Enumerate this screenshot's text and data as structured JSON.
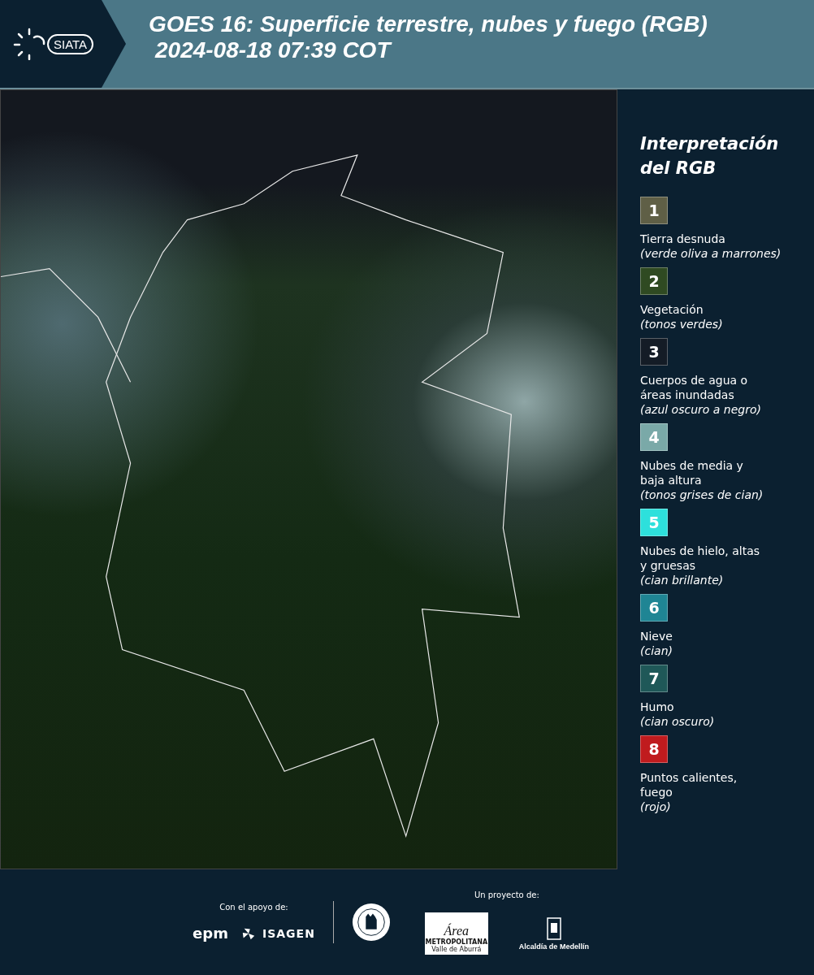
{
  "header": {
    "logo_text": "SIATA",
    "title": "GOES 16: Superficie terrestre, nubes y fuego (RGB)",
    "timestamp": "2024-08-18 07:39 COT"
  },
  "legend": {
    "title": "Interpretación del RGB",
    "items": [
      {
        "number": "1",
        "color": "#5f5f46",
        "label": "Tierra desnuda",
        "note": "(verde oliva a marrones)"
      },
      {
        "number": "2",
        "color": "#2f4a22",
        "label": "Vegetación",
        "note": "(tonos verdes)"
      },
      {
        "number": "3",
        "color": "#141c26",
        "label": "Cuerpos de agua o áreas inundadas",
        "note": "(azul oscuro a negro)"
      },
      {
        "number": "4",
        "color": "#7aa9a8",
        "label": "Nubes de media y baja altura",
        "note": "(tonos grises de cian)"
      },
      {
        "number": "5",
        "color": "#2de0dc",
        "label": "Nubes de hielo, altas y gruesas",
        "note": "(cian brillante)"
      },
      {
        "number": "6",
        "color": "#1f8594",
        "label": "Nieve",
        "note": "(cian)"
      },
      {
        "number": "7",
        "color": "#1f5858",
        "label": "Humo",
        "note": "(cian oscuro)"
      },
      {
        "number": "8",
        "color": "#c01b1e",
        "label": "Puntos calientes, fuego",
        "note": "(rojo)"
      }
    ]
  },
  "footer": {
    "support_label": "Con el apoyo de:",
    "project_label": "Un proyecto de:",
    "epm": "epm",
    "isagen": "ISAGEN",
    "area_lines": [
      "Área",
      "METROPOLITANA",
      "Valle de Aburrá"
    ],
    "alcaldia": "Alcaldía de Medellín"
  }
}
